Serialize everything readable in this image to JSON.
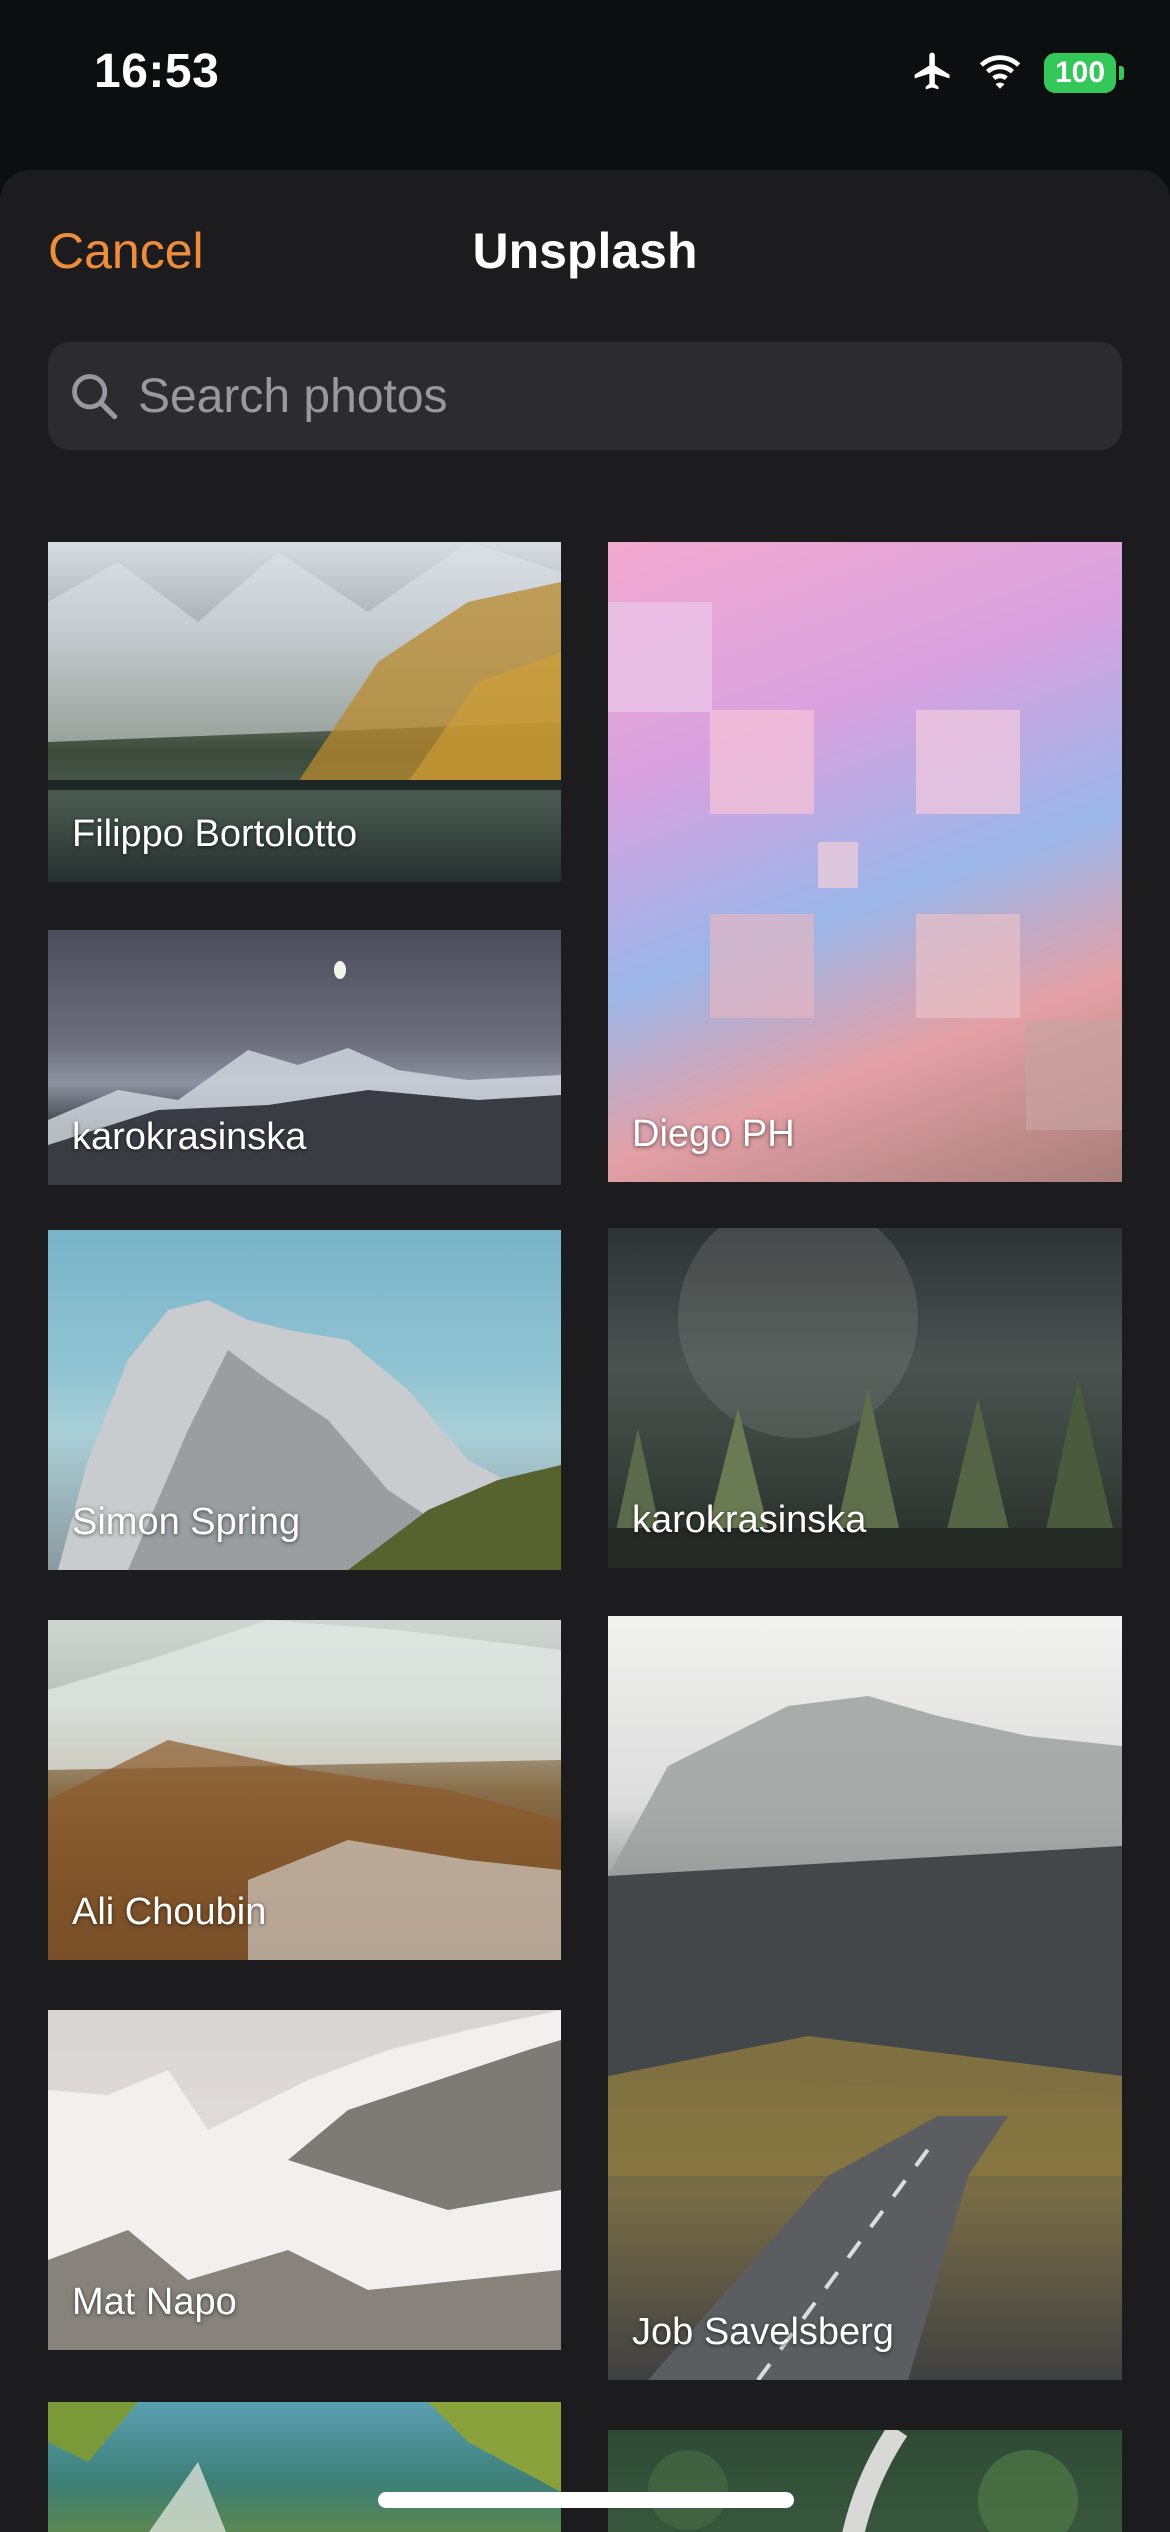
{
  "status": {
    "time": "16:53",
    "battery": "100"
  },
  "nav": {
    "cancel_label": "Cancel",
    "title": "Unsplash"
  },
  "search": {
    "placeholder": "Search photos",
    "value": ""
  },
  "photos": [
    {
      "author": "Filippo Bortolotto"
    },
    {
      "author": "karokrasinska"
    },
    {
      "author": "Simon Spring"
    },
    {
      "author": "Ali Choubin"
    },
    {
      "author": "Mat Napo"
    },
    {
      "author": "Diego PH"
    },
    {
      "author": "karokrasinska"
    },
    {
      "author": "Job Savelsberg"
    }
  ],
  "colors": {
    "accent": "#ee8e3c",
    "background": "#1c1c1e",
    "search_field": "#2c2c2e",
    "battery": "#34c759"
  }
}
